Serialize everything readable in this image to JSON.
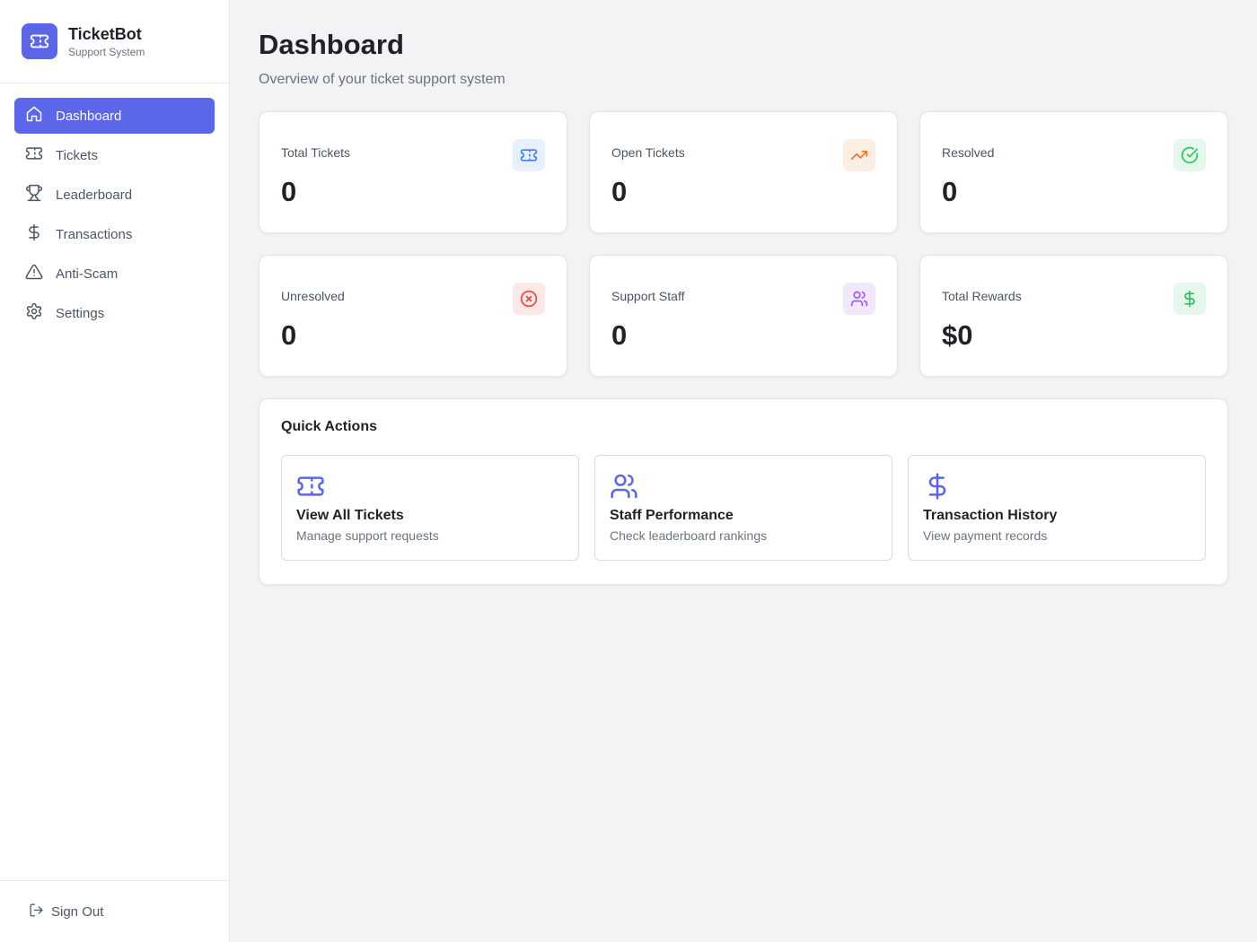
{
  "brand": {
    "title": "TicketBot",
    "subtitle": "Support System"
  },
  "nav": {
    "items": [
      {
        "label": "Dashboard",
        "icon": "home-icon",
        "active": true
      },
      {
        "label": "Tickets",
        "icon": "ticket-icon"
      },
      {
        "label": "Leaderboard",
        "icon": "trophy-icon"
      },
      {
        "label": "Transactions",
        "icon": "dollar-icon"
      },
      {
        "label": "Anti-Scam",
        "icon": "warning-icon"
      },
      {
        "label": "Settings",
        "icon": "gear-icon"
      }
    ],
    "sign_out": "Sign Out"
  },
  "header": {
    "title": "Dashboard",
    "subtitle": "Overview of your ticket support system"
  },
  "stats": [
    {
      "label": "Total Tickets",
      "value": "0",
      "icon": "ticket-icon",
      "color": "#3b82f6",
      "bg": "#e8f0fe"
    },
    {
      "label": "Open Tickets",
      "value": "0",
      "icon": "trending-up-icon",
      "color": "#f97316",
      "bg": "#fdeee3"
    },
    {
      "label": "Resolved",
      "value": "0",
      "icon": "check-circle-icon",
      "color": "#22c55e",
      "bg": "#e6f7ec"
    },
    {
      "label": "Unresolved",
      "value": "0",
      "icon": "x-circle-icon",
      "color": "#ef4444",
      "bg": "#fde8e8"
    },
    {
      "label": "Support Staff",
      "value": "0",
      "icon": "users-icon",
      "color": "#a855f7",
      "bg": "#f2e8fd"
    },
    {
      "label": "Total Rewards",
      "value": "$0",
      "icon": "dollar-icon",
      "color": "#22c55e",
      "bg": "#e6f7ec"
    }
  ],
  "quick_actions": {
    "title": "Quick Actions",
    "items": [
      {
        "title": "View All Tickets",
        "description": "Manage support requests",
        "icon": "ticket-icon"
      },
      {
        "title": "Staff Performance",
        "description": "Check leaderboard rankings",
        "icon": "users-icon"
      },
      {
        "title": "Transaction History",
        "description": "View payment records",
        "icon": "dollar-icon"
      }
    ]
  },
  "colors": {
    "accent": "#5b67e8"
  }
}
